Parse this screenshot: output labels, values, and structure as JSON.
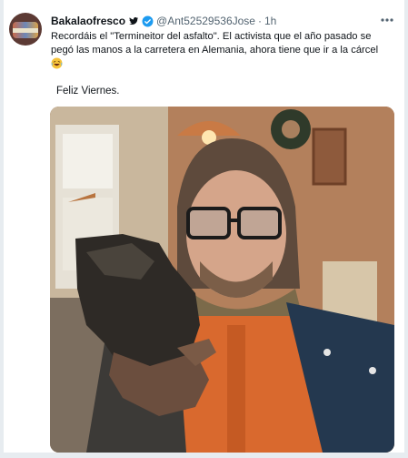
{
  "tweet": {
    "author_name": "Bakalaofresco",
    "handle": "@Ant52529536Jose",
    "separator": "·",
    "time": "1h",
    "text_line1": "Recordáis el \"Termineitor del asfalto\". El activista que el año pasado se pegó las manos a la carretera en Alemania, ahora tiene que ir a la cárcel",
    "text_line2": "Feliz Viernes.",
    "emoji": "laughing-face-icon",
    "icons": {
      "avatar": "profile-avatar",
      "bird": "bird-icon",
      "verified": "verified-badge-icon",
      "more": "more-options-icon"
    },
    "colors": {
      "handle": "#536471",
      "verified": "#1d9bf0",
      "bird": "#0f1419"
    },
    "media": {
      "description_icon": "photo-man-holding-asphalt"
    }
  }
}
